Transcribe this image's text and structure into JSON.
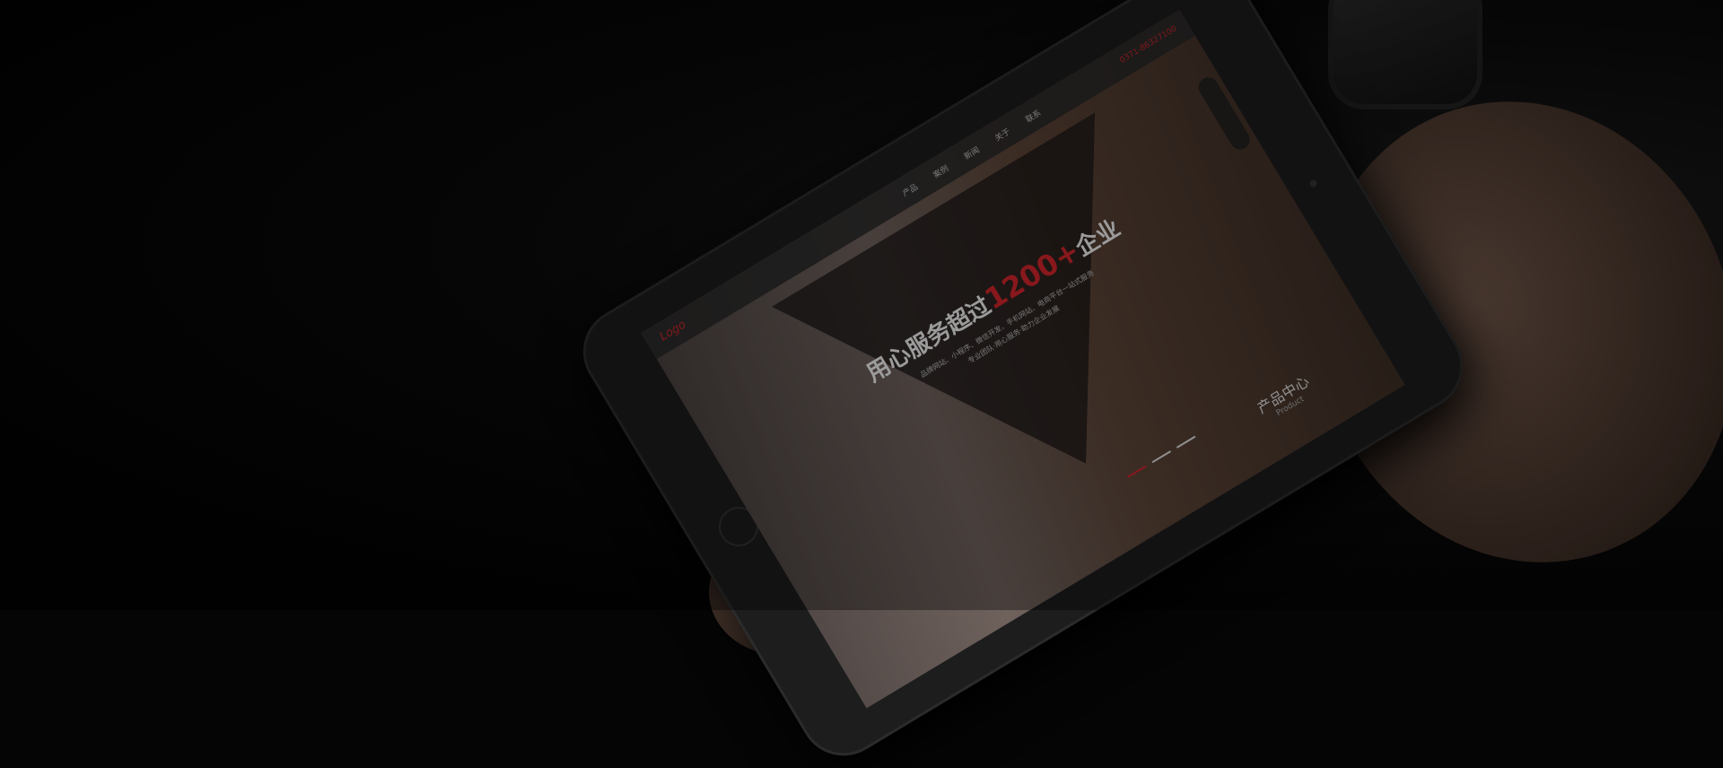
{
  "site": {
    "logo": "Logo",
    "nav": [
      "产品",
      "案例",
      "新闻",
      "关于",
      "联系"
    ],
    "phone": "0371-86327100",
    "headline_prefix": "用心服务超过",
    "headline_number": "1200+",
    "headline_suffix": "企业",
    "subtitle_1": "品牌网站、小程序、微信开发、手机网站、电商平台一站式服务",
    "subtitle_2": "专业团队·用心服务·助力企业发展",
    "product_title": "产品中心",
    "product_subtitle": "Product"
  }
}
